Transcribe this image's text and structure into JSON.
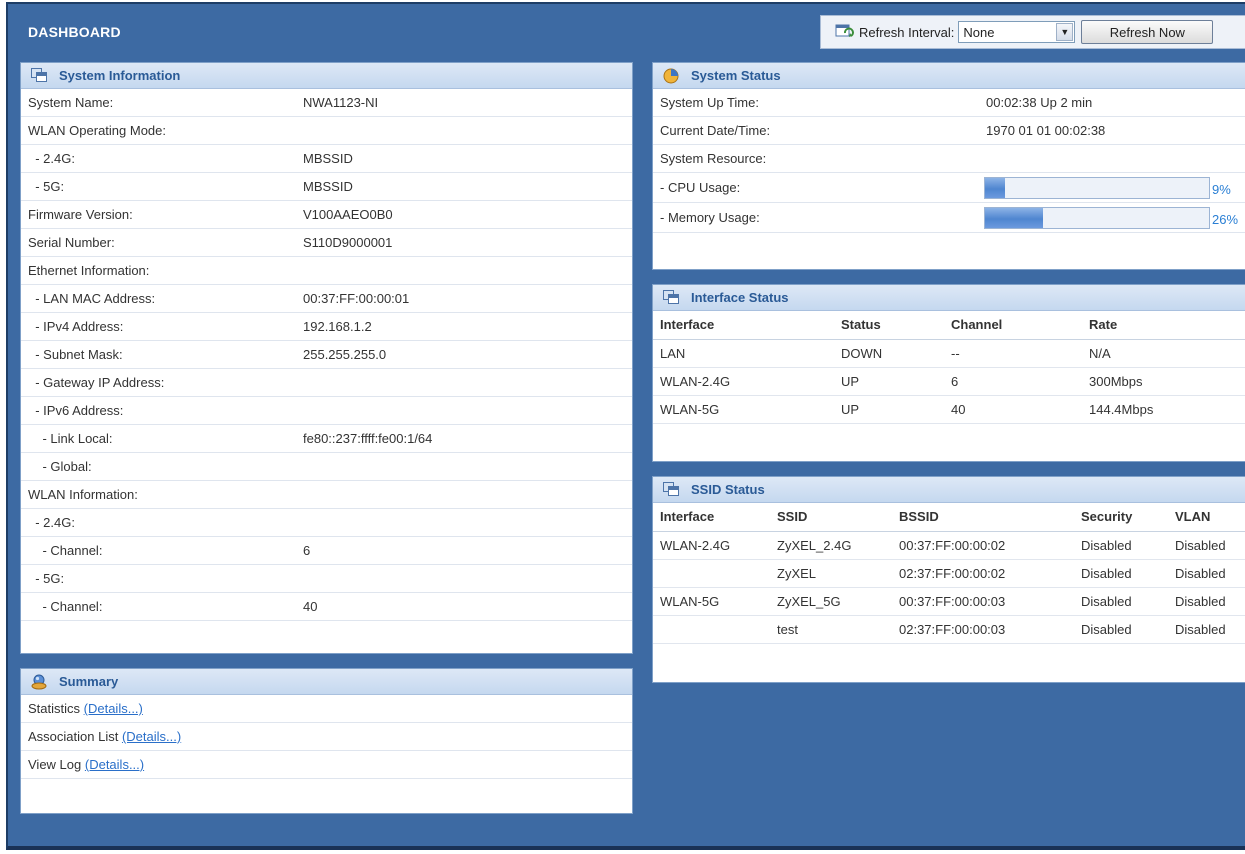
{
  "page": {
    "title": "DASHBOARD"
  },
  "refresh": {
    "label": "Refresh Interval:",
    "interval_value": "None",
    "button_label": "Refresh Now"
  },
  "system_info": {
    "title": "System Information",
    "rows": [
      {
        "label": "System Name:",
        "value": "NWA1123-NI"
      },
      {
        "label": "WLAN Operating Mode:",
        "value": ""
      },
      {
        "label": "  - 2.4G:",
        "value": "MBSSID"
      },
      {
        "label": "  - 5G:",
        "value": "MBSSID"
      },
      {
        "label": "Firmware Version:",
        "value": "V100AAEO0B0"
      },
      {
        "label": "Serial Number:",
        "value": "S110D9000001"
      },
      {
        "label": "Ethernet Information:",
        "value": ""
      },
      {
        "label": "  - LAN MAC Address:",
        "value": "00:37:FF:00:00:01"
      },
      {
        "label": "  - IPv4 Address:",
        "value": "192.168.1.2"
      },
      {
        "label": "  - Subnet Mask:",
        "value": "255.255.255.0"
      },
      {
        "label": "  - Gateway IP Address:",
        "value": ""
      },
      {
        "label": "  - IPv6 Address:",
        "value": ""
      },
      {
        "label": "    - Link Local:",
        "value": "fe80::237:ffff:fe00:1/64"
      },
      {
        "label": "    - Global:",
        "value": ""
      },
      {
        "label": "WLAN Information:",
        "value": ""
      },
      {
        "label": "  - 2.4G:",
        "value": ""
      },
      {
        "label": "    - Channel:",
        "value": "6"
      },
      {
        "label": "  - 5G:",
        "value": ""
      },
      {
        "label": "    - Channel:",
        "value": "40"
      }
    ]
  },
  "summary": {
    "title": "Summary",
    "items": [
      {
        "label": "Statistics",
        "link": "(Details...)"
      },
      {
        "label": "Association List",
        "link": "(Details...)"
      },
      {
        "label": "View Log",
        "link": "(Details...)"
      }
    ]
  },
  "system_status": {
    "title": "System Status",
    "up_time_label": "System Up Time:",
    "up_time_value": "00:02:38  Up  2 min",
    "date_label": "Current Date/Time:",
    "date_value": "1970 01 01 00:02:38",
    "resource_label": "System Resource:",
    "cpu_label": "- CPU Usage:",
    "cpu_percent": 9,
    "cpu_text": "9%",
    "mem_label": "- Memory Usage:",
    "mem_percent": 26,
    "mem_text": "26%"
  },
  "interface_status": {
    "title": "Interface Status",
    "headers": [
      "Interface",
      "Status",
      "Channel",
      "Rate"
    ],
    "rows": [
      [
        "LAN",
        "DOWN",
        "--",
        "N/A"
      ],
      [
        "WLAN-2.4G",
        "UP",
        "6",
        "300Mbps"
      ],
      [
        "WLAN-5G",
        "UP",
        "40",
        "144.4Mbps"
      ]
    ]
  },
  "ssid_status": {
    "title": "SSID Status",
    "headers": [
      "Interface",
      "SSID",
      "BSSID",
      "Security",
      "VLAN"
    ],
    "rows": [
      [
        "WLAN-2.4G",
        "ZyXEL_2.4G",
        "00:37:FF:00:00:02",
        "Disabled",
        "Disabled"
      ],
      [
        "",
        "ZyXEL",
        "02:37:FF:00:00:02",
        "Disabled",
        "Disabled"
      ],
      [
        "WLAN-5G",
        "ZyXEL_5G",
        "00:37:FF:00:00:03",
        "Disabled",
        "Disabled"
      ],
      [
        "",
        "test",
        "02:37:FF:00:00:03",
        "Disabled",
        "Disabled"
      ]
    ]
  },
  "colors": {
    "frame_bg": "#3d6aa3",
    "panel_head": "#c5d8ef",
    "heading_text": "#2a5a96",
    "link": "#2a6fc9",
    "bar_fill": "#4f86d0"
  }
}
